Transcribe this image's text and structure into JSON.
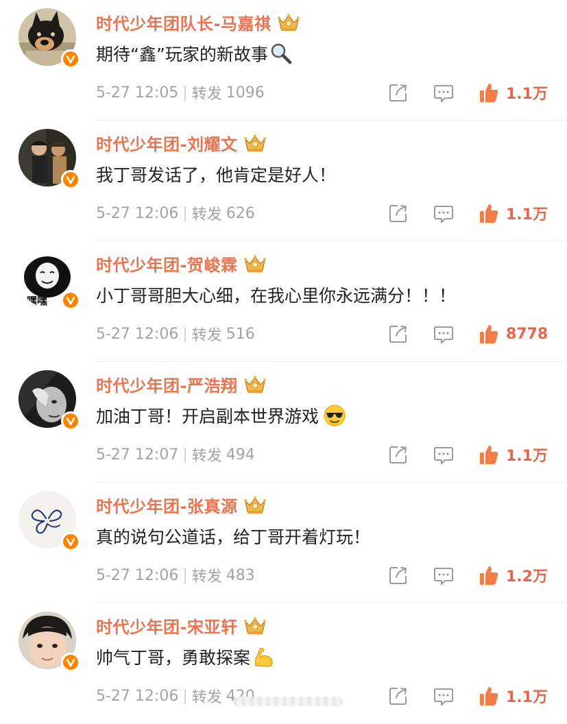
{
  "colors": {
    "username": "#eb7350",
    "comment_text": "#222222",
    "meta_text": "#a3a3a3",
    "like_count": "#e8654b",
    "verified_badge": "#ff8200",
    "like_icon": "#f27d45"
  },
  "comments": [
    {
      "username": "时代少年团队长-马嘉祺",
      "text": "期待“鑫”玩家的新故事",
      "emoji": "magnifier-emoji",
      "time": "5-27 12:05",
      "repost_label": "转发",
      "repost_count": "1096",
      "like_count": "1.1万",
      "avatar": "dog-avatar"
    },
    {
      "username": "时代少年团-刘耀文",
      "text": "我丁哥发话了，他肯定是好人！",
      "emoji": "",
      "time": "5-27 12:06",
      "repost_label": "转发",
      "repost_count": "626",
      "like_count": "1.1万",
      "avatar": "photo-avatar"
    },
    {
      "username": "时代少年团-贺峻霖",
      "text": "小丁哥哥胆大心细，在我心里你永远满分！！！",
      "emoji": "",
      "time": "5-27 12:06",
      "repost_label": "转发",
      "repost_count": "516",
      "like_count": "8778",
      "avatar": "meme-avatar",
      "avatar_caption": "嘿嘿"
    },
    {
      "username": "时代少年团-严浩翔",
      "text": "加油丁哥！开启副本世界游戏",
      "emoji": "sunglasses-emoji",
      "time": "5-27 12:07",
      "repost_label": "转发",
      "repost_count": "494",
      "like_count": "1.1万",
      "avatar": "bw-photo-avatar"
    },
    {
      "username": "时代少年团-张真源",
      "text": "真的说句公道话，给丁哥开着灯玩！",
      "emoji": "",
      "time": "5-27 12:06",
      "repost_label": "转发",
      "repost_count": "483",
      "like_count": "1.2万",
      "avatar": "butterfly-avatar"
    },
    {
      "username": "时代少年团-宋亚轩",
      "text": "帅气丁哥，勇敢探案",
      "emoji": "flexed-bicep-emoji",
      "time": "5-27 12:06",
      "repost_label": "转发",
      "repost_count": "420",
      "like_count": "1.1万",
      "avatar": "selfie-avatar"
    }
  ]
}
